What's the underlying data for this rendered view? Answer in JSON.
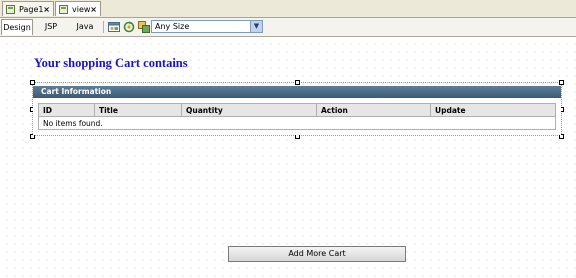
{
  "editor_tabs": [
    {
      "label": "Page1",
      "close": "×"
    },
    {
      "label": "view",
      "close": "×"
    }
  ],
  "view_tabs": {
    "design": "Design",
    "jsp": "JSP",
    "java": "Java"
  },
  "toolbar": {
    "size_select_value": "Any Size"
  },
  "page": {
    "title": "Your shopping Cart contains",
    "panel_header": "Cart Information",
    "table": {
      "columns": [
        "ID",
        "Title",
        "Quantity",
        "Action",
        "Update"
      ],
      "empty_message": "No items found."
    },
    "add_more_button": "Add More Cart"
  }
}
